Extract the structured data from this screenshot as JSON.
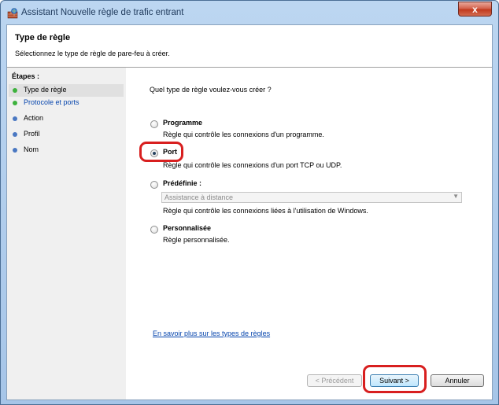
{
  "window": {
    "title": "Assistant Nouvelle règle de trafic entrant",
    "close_label": "x"
  },
  "header": {
    "title": "Type de règle",
    "subtitle": "Sélectionnez le type de règle de pare-feu à créer."
  },
  "steps": {
    "title": "Étapes :",
    "items": [
      {
        "label": "Type de règle",
        "state": "current",
        "color": "#3db23d"
      },
      {
        "label": "Protocole et ports",
        "state": "link",
        "color": "#3db23d"
      },
      {
        "label": "Action",
        "state": "pending",
        "color": "#4a78c2"
      },
      {
        "label": "Profil",
        "state": "pending",
        "color": "#4a78c2"
      },
      {
        "label": "Nom",
        "state": "pending",
        "color": "#4a78c2"
      }
    ]
  },
  "main": {
    "question": "Quel type de règle voulez-vous créer ?",
    "options": [
      {
        "title": "Programme",
        "desc": "Règle qui contrôle les connexions d'un programme.",
        "selected": false
      },
      {
        "title": "Port",
        "desc": "Règle qui contrôle les connexions d'un port TCP ou UDP.",
        "selected": true
      },
      {
        "title": "Prédéfinie :",
        "desc": "Règle qui contrôle les connexions liées à l'utilisation de Windows.",
        "selected": false
      },
      {
        "title": "Personnalisée",
        "desc": "Règle personnalisée.",
        "selected": false
      }
    ],
    "predefined_combo": "Assistance à distance",
    "learn_more": "En savoir plus sur les types de règles"
  },
  "buttons": {
    "previous": "< Précédent",
    "next": "Suivant >",
    "cancel": "Annuler"
  },
  "colors": {
    "highlight": "#d81f1f",
    "link": "#0645ad"
  }
}
